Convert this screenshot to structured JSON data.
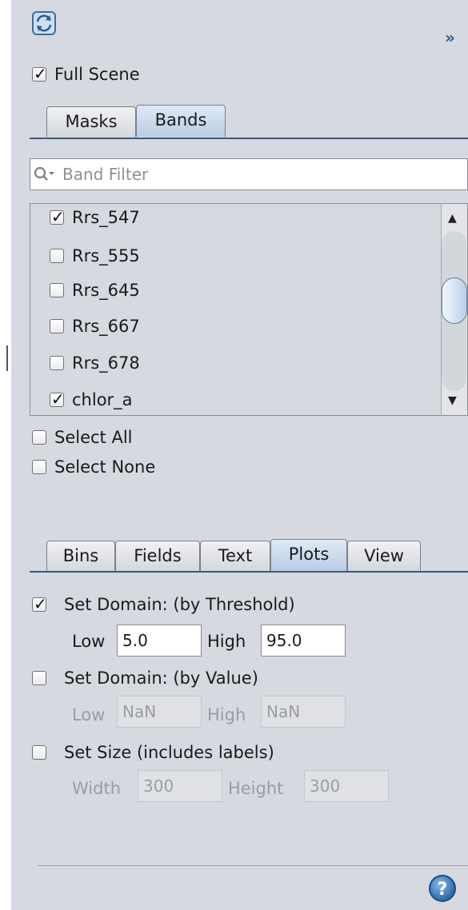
{
  "toolbar": {
    "refresh_icon": "refresh-icon",
    "collapse_glyph": "»"
  },
  "full_scene": {
    "label": "Full Scene",
    "checked": true
  },
  "top_tabs": [
    {
      "label": "Masks",
      "active": false
    },
    {
      "label": "Bands",
      "active": true
    }
  ],
  "band_filter": {
    "placeholder": "Band Filter",
    "icon": "search-icon"
  },
  "bands": [
    {
      "label": "Rrs_547",
      "checked": true
    },
    {
      "label": "Rrs_555",
      "checked": false
    },
    {
      "label": "Rrs_645",
      "checked": false
    },
    {
      "label": "Rrs_667",
      "checked": false
    },
    {
      "label": "Rrs_678",
      "checked": false
    },
    {
      "label": "chlor_a",
      "checked": true
    }
  ],
  "select_all": {
    "label": "Select All",
    "checked": false
  },
  "select_none": {
    "label": "Select None",
    "checked": false
  },
  "bottom_tabs": [
    {
      "label": "Bins",
      "active": false
    },
    {
      "label": "Fields",
      "active": false
    },
    {
      "label": "Text",
      "active": false
    },
    {
      "label": "Plots",
      "active": true
    },
    {
      "label": "View",
      "active": false
    }
  ],
  "domain_threshold": {
    "label": "Set Domain: (by Threshold)",
    "checked": true,
    "low_label": "Low",
    "low_value": "5.0",
    "high_label": "High",
    "high_value": "95.0"
  },
  "domain_value": {
    "label": "Set Domain: (by Value)",
    "checked": false,
    "low_label": "Low",
    "low_value": "NaN",
    "high_label": "High",
    "high_value": "NaN"
  },
  "set_size": {
    "label": "Set Size (includes labels)",
    "checked": false,
    "width_label": "Width",
    "width_value": "300",
    "height_label": "Height",
    "height_value": "300"
  },
  "help_icon": "help-icon"
}
